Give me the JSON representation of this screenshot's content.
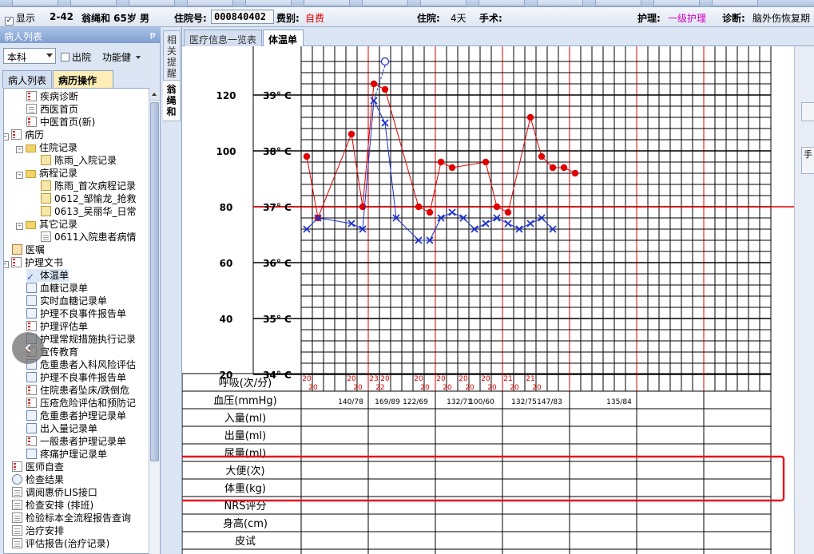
{
  "patient_bar": {
    "show_label": "显示",
    "bed": "2-42",
    "name_age_sex": "翁绳和 65岁 男",
    "inpatient_no_label": "住院号:",
    "inpatient_no": "000840402",
    "fee_type_label": "费别:",
    "fee_type": "自费",
    "stay_label": "住院:",
    "stay_days": "4天",
    "surgery_label": "手术:",
    "nursing_label": "护理:",
    "nursing_level": "一级护理",
    "diagnosis_label": "诊断:",
    "diagnosis": "脑外伤恢复期"
  },
  "left_panel": {
    "title": "病人列表",
    "pin": "ᵽ",
    "dept": "本科",
    "discharged_label": "出院",
    "funckey_label": "功能健",
    "tabs": [
      "病人列表",
      "病历操作"
    ],
    "tree": [
      {
        "label": "疾病诊断",
        "icon": "red-doc-icon",
        "level": 1
      },
      {
        "label": "西医首页",
        "icon": "doc-icon",
        "level": 1
      },
      {
        "label": "中医首页(新)",
        "icon": "red-doc-icon",
        "level": 1
      },
      {
        "label": "病历",
        "icon": "red-doc-icon",
        "level": 0,
        "expander": "-"
      },
      {
        "label": "住院记录",
        "icon": "folder-icon",
        "level": 1,
        "expander": "-"
      },
      {
        "label": "陈雨_入院记录",
        "icon": "lock-doc-icon",
        "level": 2
      },
      {
        "label": "病程记录",
        "icon": "folder-icon",
        "level": 1,
        "expander": "-"
      },
      {
        "label": "陈雨_首次病程记录",
        "icon": "lock-doc-icon",
        "level": 2
      },
      {
        "label": "0612_邹愉龙_抢救",
        "icon": "lock-doc-icon",
        "level": 2
      },
      {
        "label": "0613_吴丽华_日常",
        "icon": "lock-doc-icon",
        "level": 2
      },
      {
        "label": "其它记录",
        "icon": "folder-icon",
        "level": 1,
        "expander": "-"
      },
      {
        "label": "0611入院患者病情",
        "icon": "doc-icon",
        "level": 2
      },
      {
        "label": "医嘱",
        "icon": "book-icon",
        "level": 0
      },
      {
        "label": "护理文书",
        "icon": "red-doc-icon",
        "level": 0,
        "expander": "-"
      },
      {
        "label": "体温单",
        "icon": "check-icon",
        "level": 1,
        "selected": true
      },
      {
        "label": "血糖记录单",
        "icon": "blue-doc-icon",
        "level": 1
      },
      {
        "label": "实时血糖记录单",
        "icon": "blue-doc-icon",
        "level": 1
      },
      {
        "label": "护理不良事件报告单",
        "icon": "blue-doc-icon",
        "level": 1
      },
      {
        "label": "护理评估单",
        "icon": "red-doc-icon",
        "level": 1
      },
      {
        "label": "护理常规措施执行记录",
        "icon": "blue-doc-icon",
        "level": 1
      },
      {
        "label": "宣传教育",
        "icon": "red-doc-icon",
        "level": 1
      },
      {
        "label": "危重患者入科风险评估",
        "icon": "blue-doc-icon",
        "level": 1
      },
      {
        "label": "护理不良事件报告单",
        "icon": "blue-doc-icon",
        "level": 1
      },
      {
        "label": "住院患者坠床/跌倒危",
        "icon": "red-doc-icon",
        "level": 1
      },
      {
        "label": "压疮危险评估和预防记",
        "icon": "red-doc-icon",
        "level": 1
      },
      {
        "label": "危重患者护理记录单",
        "icon": "blue-doc-icon",
        "level": 1
      },
      {
        "label": "出入量记录单",
        "icon": "blue-doc-icon",
        "level": 1
      },
      {
        "label": "一般患者护理记录单",
        "icon": "red-doc-icon",
        "level": 1
      },
      {
        "label": "疼痛护理记录单",
        "icon": "blue-doc-icon",
        "level": 1
      },
      {
        "label": "医师自查",
        "icon": "red-doc-icon",
        "level": 0
      },
      {
        "label": "检查结果",
        "icon": "magnifier-icon",
        "level": 0
      },
      {
        "label": "调阅惠侨LIS接口",
        "icon": "doc-icon",
        "level": 0
      },
      {
        "label": "检查安排 (排班)",
        "icon": "doc-icon",
        "level": 0
      },
      {
        "label": "检验标本全流程报告查询",
        "icon": "doc-icon",
        "level": 0
      },
      {
        "label": "治疗安排",
        "icon": "doc-icon",
        "level": 0
      },
      {
        "label": "评估报告(治疗记录)",
        "icon": "doc-icon",
        "level": 0
      }
    ]
  },
  "vertical_tabs": [
    "相关提醒",
    "翁绳和"
  ],
  "doc_tabs": [
    "医疗信息一览表",
    "体温单"
  ],
  "chart_data": {
    "type": "line",
    "y_pulse_ticks": [
      "120",
      "100",
      "80",
      "60",
      "40",
      "20"
    ],
    "y_temp_ticks": [
      "39° C",
      "38° C",
      "37° C",
      "36° C",
      "35° C",
      "34° C"
    ],
    "y_pulse_range": [
      20,
      130
    ],
    "y_temp_range": [
      34,
      39.5
    ],
    "series": [
      {
        "color": "#e00000",
        "marker": "dot",
        "points": [
          [
            0,
            37.9
          ],
          [
            1,
            36.8
          ],
          [
            4,
            38.3
          ],
          [
            5,
            37.0
          ],
          [
            6,
            39.2
          ],
          [
            7,
            39.1
          ],
          [
            10,
            37.0
          ],
          [
            11,
            36.9
          ],
          [
            12,
            37.8
          ],
          [
            13,
            37.7
          ],
          [
            16,
            37.8
          ],
          [
            17,
            37.0
          ],
          [
            18,
            36.9
          ],
          [
            20,
            38.6
          ],
          [
            21,
            37.9
          ],
          [
            22,
            37.7
          ],
          [
            23,
            37.7
          ],
          [
            24,
            37.6
          ]
        ]
      },
      {
        "color": "#1a2fd0",
        "marker": "x",
        "points": [
          [
            0,
            36.6
          ],
          [
            1,
            36.8
          ],
          [
            4,
            36.7
          ],
          [
            5,
            36.6
          ],
          [
            6,
            38.9
          ],
          [
            7,
            38.5
          ],
          [
            8,
            36.8
          ],
          [
            10,
            36.4
          ],
          [
            11,
            36.4
          ],
          [
            12,
            36.8
          ],
          [
            13,
            36.9
          ],
          [
            14,
            36.8
          ],
          [
            15,
            36.6
          ],
          [
            16,
            36.7
          ],
          [
            17,
            36.8
          ],
          [
            18,
            36.7
          ],
          [
            19,
            36.6
          ],
          [
            20,
            36.7
          ],
          [
            21,
            36.8
          ],
          [
            22,
            36.6
          ]
        ]
      }
    ],
    "temp_reference": 37.0,
    "row_labels": [
      "呼吸(次/分)",
      "血压(mmHg)",
      "入量(ml)",
      "出量(ml)",
      "尿量(ml)",
      "大便(次)",
      "体重(kg)",
      "NRS评分",
      "身高(cm)",
      "皮试"
    ],
    "respiration": [
      {
        "col": 0,
        "top": "20",
        "bottom": "20"
      },
      {
        "col": 4,
        "top": "20",
        "bottom": "20"
      },
      {
        "col": 6,
        "top": "23",
        "bottom": "22"
      },
      {
        "col": 7,
        "top": "20",
        "bottom": ""
      },
      {
        "col": 10,
        "top": "20",
        "bottom": "20"
      },
      {
        "col": 12,
        "top": "20",
        "bottom": "20"
      },
      {
        "col": 14,
        "top": "20",
        "bottom": "20"
      },
      {
        "col": 16,
        "top": "20",
        "bottom": "20"
      },
      {
        "col": 18,
        "top": "21",
        "bottom": "20"
      },
      {
        "col": 20,
        "top": "21",
        "bottom": "20"
      }
    ],
    "blood_pressure": [
      "140/78",
      "169/89",
      "122/69",
      "132/71",
      "100/60",
      "132/75",
      "147/83",
      "135/84"
    ]
  },
  "colors": {
    "grid": "#000000",
    "day_line": "#e00000",
    "temp_line": "#e00000",
    "highlight_box": "#e8101a"
  }
}
